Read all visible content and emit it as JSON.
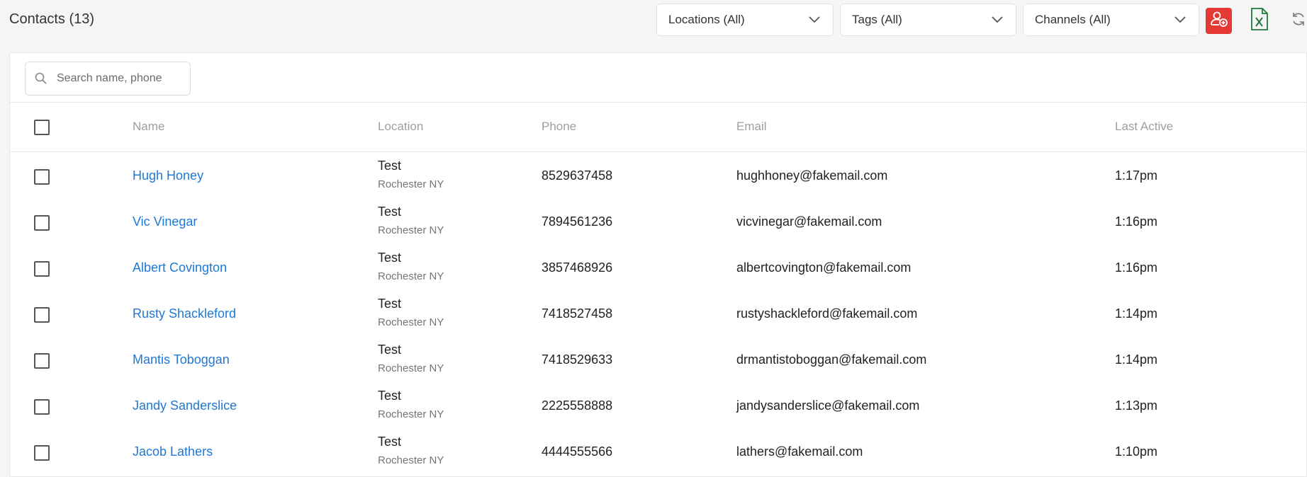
{
  "header": {
    "title": "Contacts (13)",
    "filters": {
      "locations": "Locations (All)",
      "tags": "Tags (All)",
      "channels": "Channels (All)"
    },
    "actions": {
      "add_contact_icon": "add-person-icon",
      "export_icon": "excel-export-icon",
      "refresh_icon": "refresh-icon"
    }
  },
  "search": {
    "placeholder": "Search name, phone",
    "value": ""
  },
  "table": {
    "columns": {
      "name": "Name",
      "location": "Location",
      "phone": "Phone",
      "email": "Email",
      "last_active": "Last Active"
    },
    "rows": [
      {
        "name": "Hugh Honey",
        "location": "Test",
        "location_sub": "Rochester NY",
        "phone": "8529637458",
        "email": "hughhoney@fakemail.com",
        "last_active": "1:17pm"
      },
      {
        "name": "Vic Vinegar",
        "location": "Test",
        "location_sub": "Rochester NY",
        "phone": "7894561236",
        "email": "vicvinegar@fakemail.com",
        "last_active": "1:16pm"
      },
      {
        "name": "Albert Covington",
        "location": "Test",
        "location_sub": "Rochester NY",
        "phone": "3857468926",
        "email": "albertcovington@fakemail.com",
        "last_active": "1:16pm"
      },
      {
        "name": "Rusty Shackleford",
        "location": "Test",
        "location_sub": "Rochester NY",
        "phone": "7418527458",
        "email": "rustyshackleford@fakemail.com",
        "last_active": "1:14pm"
      },
      {
        "name": "Mantis Toboggan",
        "location": "Test",
        "location_sub": "Rochester NY",
        "phone": "7418529633",
        "email": "drmantistoboggan@fakemail.com",
        "last_active": "1:14pm"
      },
      {
        "name": "Jandy Sanderslice",
        "location": "Test",
        "location_sub": "Rochester NY",
        "phone": "2225558888",
        "email": "jandysanderslice@fakemail.com",
        "last_active": "1:13pm"
      },
      {
        "name": "Jacob Lathers",
        "location": "Test",
        "location_sub": "Rochester NY",
        "phone": "4444555566",
        "email": "lathers@fakemail.com",
        "last_active": "1:10pm"
      }
    ]
  },
  "colors": {
    "link": "#1e78d6",
    "add_button": "#e53935",
    "excel_green": "#1d7a3a"
  }
}
